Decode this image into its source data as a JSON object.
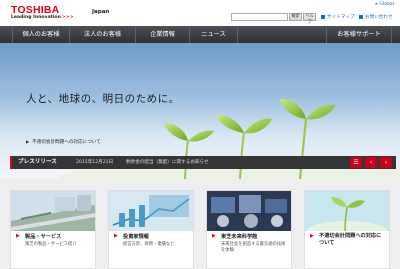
{
  "header": {
    "logo_text": "TOSHIBA",
    "tagline": "Leading Innovation",
    "tagline_chevrons": ">>>",
    "country": "Japan",
    "global_link": "▸ Global",
    "search_placeholder": "",
    "search_button": "検索",
    "help_button": "ヘルプ",
    "sitemap_link": "サイトマップ",
    "inquiry_link": "お問い合わせ"
  },
  "nav": {
    "items": [
      "個人のお客様",
      "法人のお客様",
      "企業情報",
      "ニュース",
      "お客様サポート"
    ]
  },
  "hero": {
    "catchphrase": "人と、地球の、明日のために。",
    "notice_link": "不適切会計問題への対応について"
  },
  "press": {
    "label": "プレスリリース",
    "date": "2015年12月21日",
    "headline": "剰余金の配当（無配）に関するお知らせ",
    "list_icon": "list-icon",
    "prev_icon": "chevron-left-icon",
    "next_icon": "chevron-right-icon"
  },
  "cards": [
    {
      "title": "製品・サービス",
      "desc": "東芝の製品・サービス紹介"
    },
    {
      "title": "投資家情報",
      "desc": "経営方針、財務・業績など"
    },
    {
      "title": "東芝未来科学館",
      "desc": "未来社会を創造する最先端の技術を体験"
    },
    {
      "title": "不適切会計問題への対応について",
      "desc": ""
    }
  ],
  "colors": {
    "brand_red": "#e0001b",
    "nav_bg": "#3a3c40",
    "press_bg": "#333537",
    "link_blue": "#1a6bb8"
  }
}
